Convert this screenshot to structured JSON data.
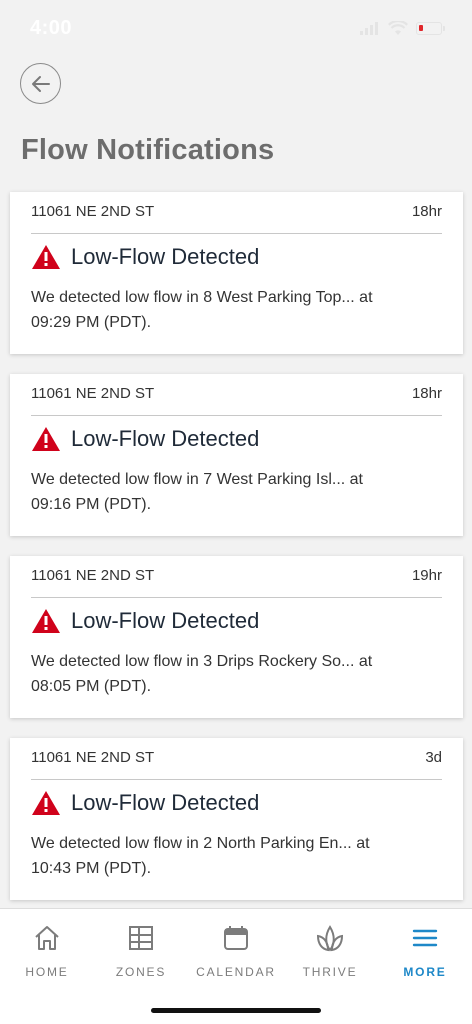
{
  "status_bar": {
    "time": "4:00"
  },
  "header": {
    "title": "Flow Notifications"
  },
  "notifications": [
    {
      "address": "11061 NE 2ND ST",
      "age": "18hr",
      "title": "Low-Flow Detected",
      "line1": "We detected low flow in 8 West Parking Top... at",
      "line2": "09:29 PM (PDT)."
    },
    {
      "address": "11061 NE 2ND ST",
      "age": "18hr",
      "title": "Low-Flow Detected",
      "line1": "We detected low flow in 7 West Parking Isl... at",
      "line2": "09:16 PM (PDT)."
    },
    {
      "address": "11061 NE 2ND ST",
      "age": "19hr",
      "title": "Low-Flow Detected",
      "line1": "We detected low flow in 3 Drips Rockery So... at",
      "line2": "08:05 PM (PDT)."
    },
    {
      "address": "11061 NE 2ND ST",
      "age": "3d",
      "title": "Low-Flow Detected",
      "line1": "We detected low flow in 2 North Parking En... at",
      "line2": "10:43 PM (PDT)."
    }
  ],
  "tabs": [
    {
      "label": "HOME",
      "icon": "home-icon"
    },
    {
      "label": "ZONES",
      "icon": "zones-grid-icon"
    },
    {
      "label": "CALENDAR",
      "icon": "calendar-icon"
    },
    {
      "label": "THRIVE",
      "icon": "leaf-icon"
    },
    {
      "label": "MORE",
      "icon": "menu-icon"
    }
  ],
  "colors": {
    "accent": "#1e88c8",
    "warning": "#d0021b",
    "title": "#6d6d6d"
  }
}
